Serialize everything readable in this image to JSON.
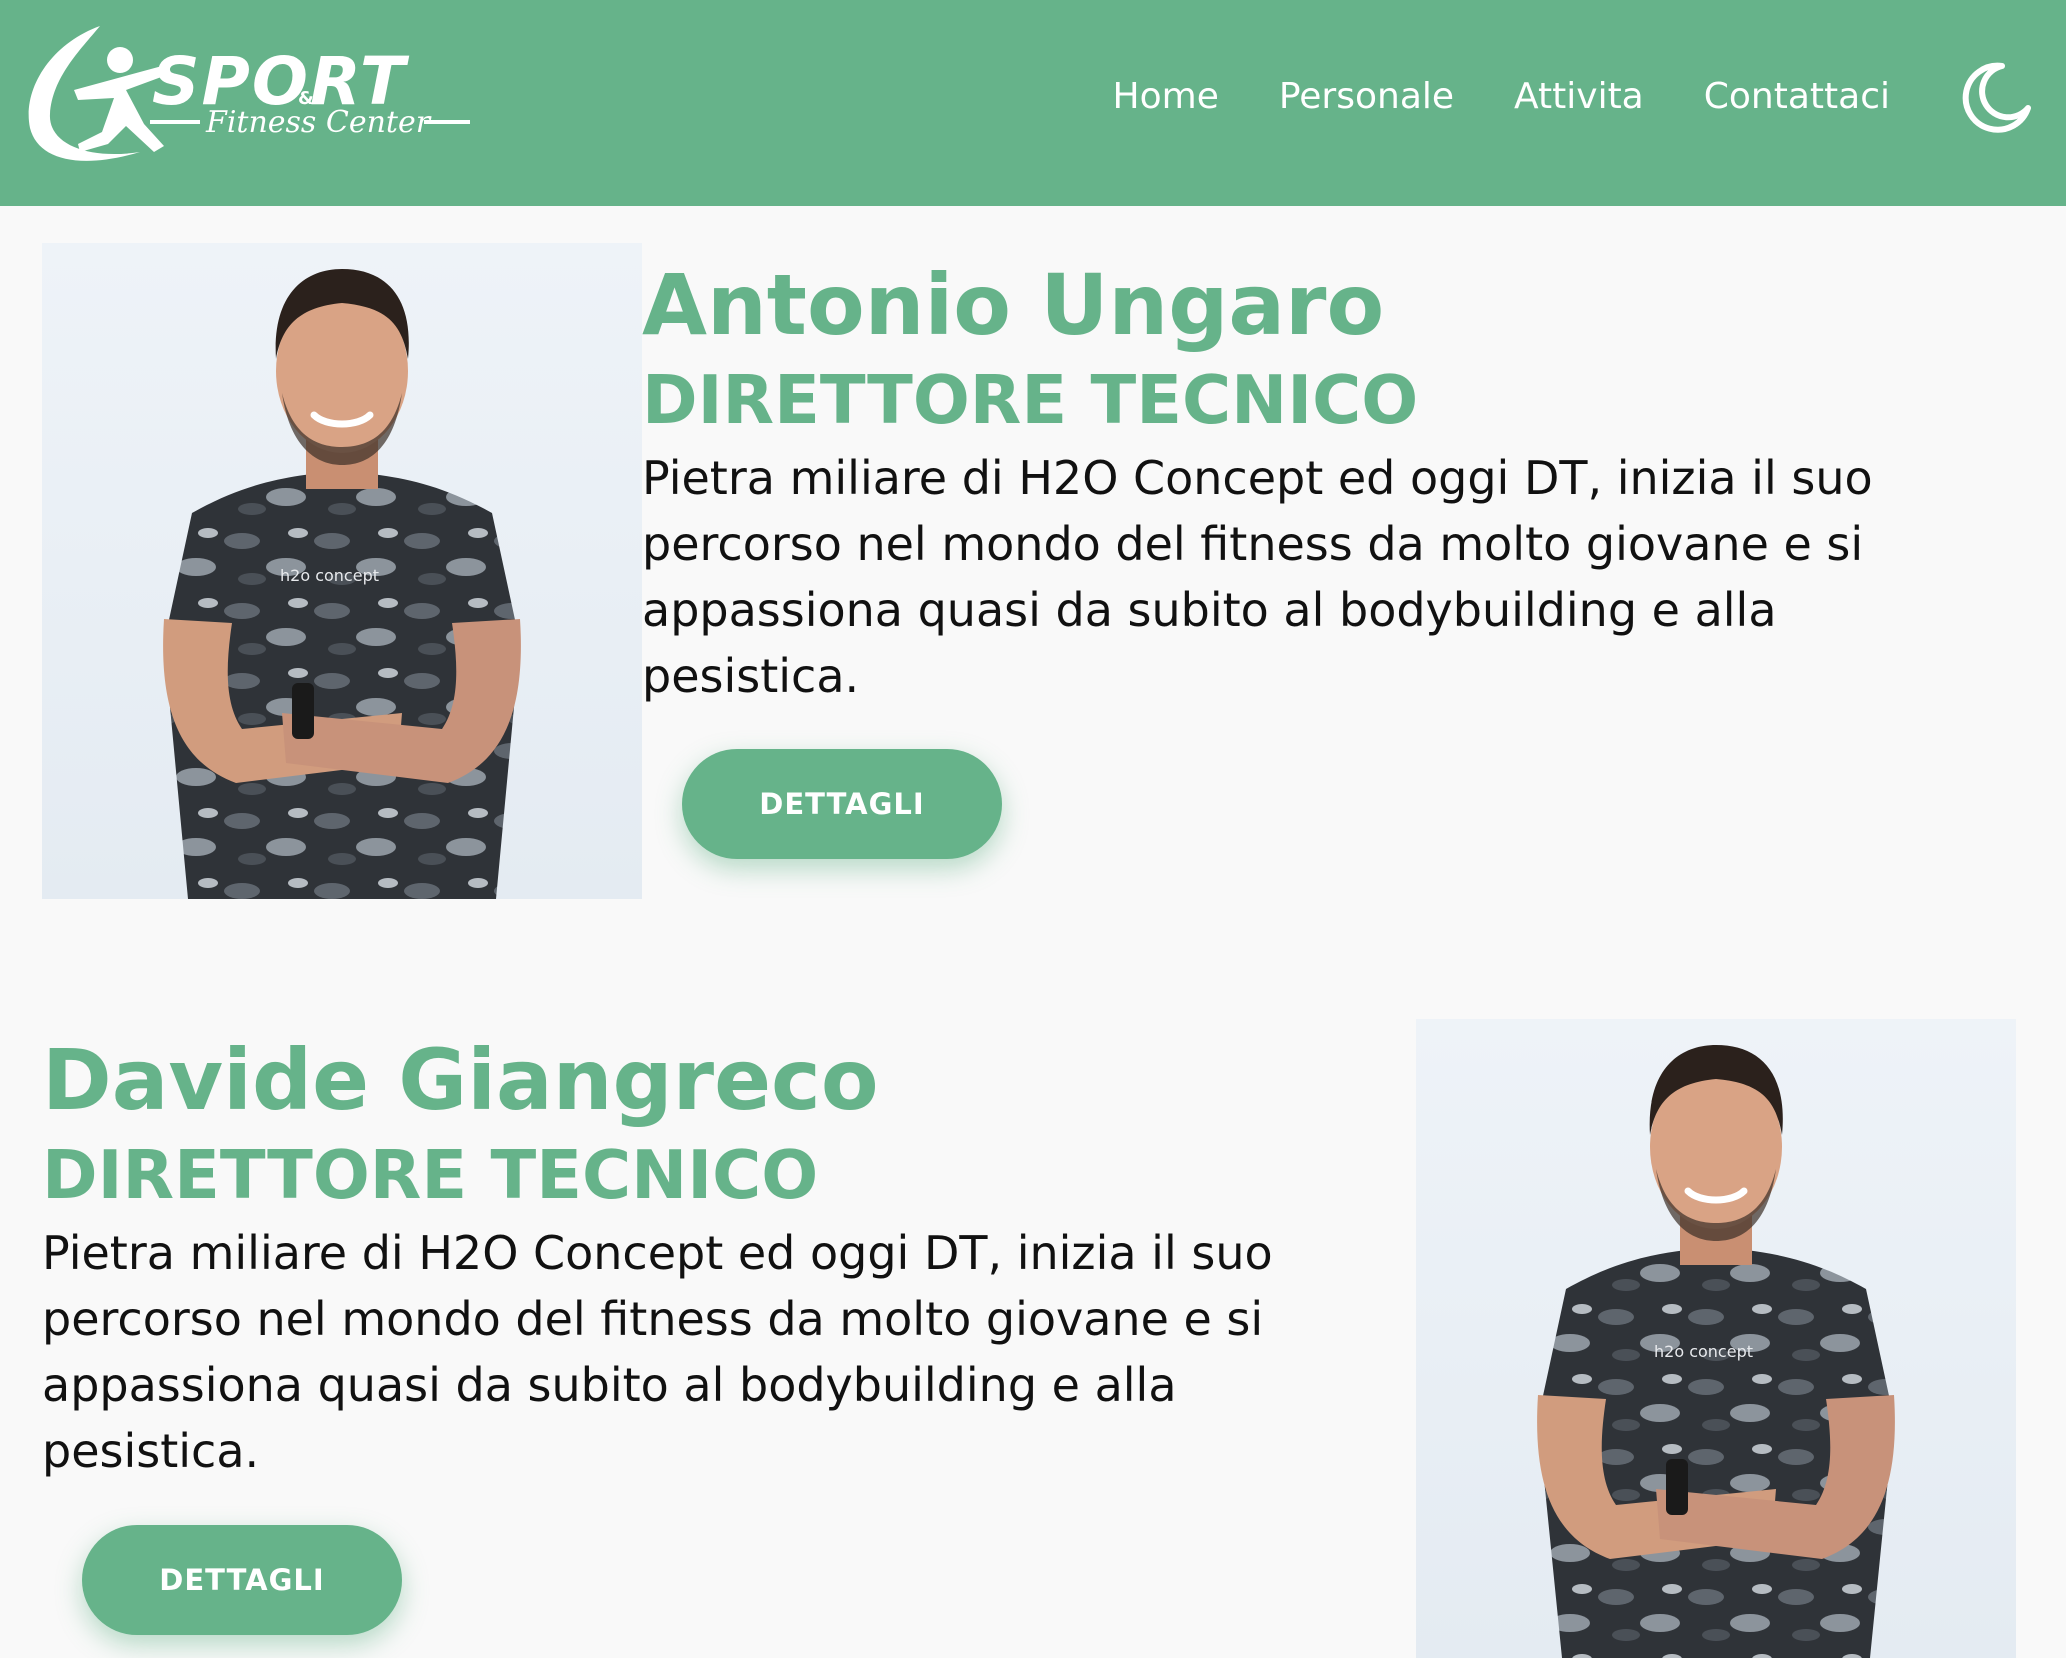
{
  "brand": {
    "logo_main": "SPORT",
    "logo_amp": "&",
    "logo_sub": "Fitness Center"
  },
  "nav": {
    "items": [
      "Home",
      "Personale",
      "Attivita",
      "Contattaci"
    ],
    "theme_icon": "moon-icon"
  },
  "colors": {
    "accent": "#66b38a",
    "background": "#f9f9f9",
    "text": "#111111"
  },
  "staff": [
    {
      "name": "Antonio Ungaro",
      "role": "DIRETTORE TECNICO",
      "description": "Pietra miliare di H2O Concept ed oggi DT, inizia il suo percorso nel mondo del fitness da molto giovane e si appassiona quasi da subito al bodybuilding e alla pesistica.",
      "button_label": "DETTAGLI",
      "shirt_logo": "h2o concept"
    },
    {
      "name": "Davide Giangreco",
      "role": "DIRETTORE TECNICO",
      "description": "Pietra miliare di H2O Concept ed oggi DT, inizia il suo percorso nel mondo del fitness da molto giovane e si appassiona quasi da subito al bodybuilding e alla pesistica.",
      "button_label": "DETTAGLI",
      "shirt_logo": "h2o concept"
    }
  ]
}
